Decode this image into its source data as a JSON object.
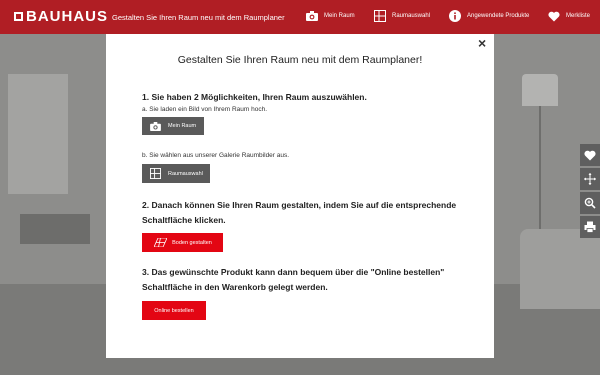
{
  "header": {
    "brand": "BAUHAUS",
    "brand_sub": "",
    "tagline": "Gestalten Sie Ihren Raum neu mit dem Raumplaner",
    "nav": [
      {
        "label": "Mein Raum",
        "icon": "camera-icon"
      },
      {
        "label": "Raumauswahl",
        "icon": "room-grid-icon"
      },
      {
        "label": "Angewendete Produkte",
        "icon": "info-icon"
      },
      {
        "label": "Merkliste",
        "icon": "heart-icon"
      }
    ]
  },
  "tools": [
    "heart-plus-icon",
    "move-icon",
    "zoom-icon",
    "print-icon"
  ],
  "modal": {
    "title": "Gestalten Sie Ihren Raum neu mit dem Raumplaner!",
    "close": "×",
    "step1": {
      "heading": "1. Sie haben 2 Möglichkeiten, Ihren Raum auszuwählen.",
      "a_text": "a. Sie laden ein Bild von Ihrem Raum hoch.",
      "a_button": "Mein Raum",
      "b_text": "b. Sie wählen aus unserer Galerie Raumbilder aus.",
      "b_button": "Raumauswahl"
    },
    "step2": {
      "heading_line1": "2. Danach können Sie Ihren Raum gestalten, indem Sie auf die entsprechende",
      "heading_line2": "Schaltfläche klicken.",
      "button": "Boden gestalten"
    },
    "step3": {
      "heading_line1": "3. Das gewünschte Produkt kann dann bequem über die \"Online bestellen\"",
      "heading_line2": "Schaltfläche in den Warenkorb gelegt werden.",
      "button": "Online bestellen"
    }
  },
  "colors": {
    "brand_red": "#b01e24",
    "button_red": "#e30613",
    "button_grey": "#5a5a5a"
  }
}
